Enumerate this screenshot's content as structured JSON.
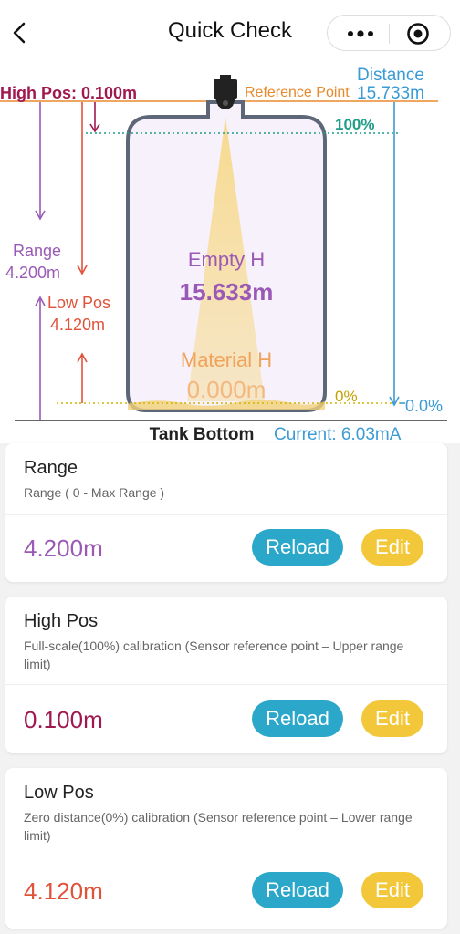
{
  "header": {
    "title": "Quick Check"
  },
  "diagram": {
    "high_pos_label": "High Pos: 0.100m",
    "reference_point": "Reference Point",
    "distance_label": "Distance",
    "distance_value": "15.733m",
    "percent_100": "100%",
    "percent_0": "0%",
    "zero_percent_right": "0.0%",
    "range_label": "Range",
    "range_value": "4.200m",
    "low_pos_label": "Low Pos",
    "low_pos_value": "4.120m",
    "empty_h_label": "Empty H",
    "empty_h_value": "15.633m",
    "material_h_label": "Material H",
    "material_h_value": "0.000m",
    "tank_bottom": "Tank Bottom",
    "current": "Current: 6.03mA"
  },
  "cards": {
    "range": {
      "title": "Range",
      "desc": "Range ( 0 - Max Range )",
      "value": "4.200m",
      "reload": "Reload",
      "edit": "Edit"
    },
    "high_pos": {
      "title": "High Pos",
      "desc": "Full-scale(100%) calibration (Sensor reference point – Upper range limit)",
      "value": "0.100m",
      "reload": "Reload",
      "edit": "Edit"
    },
    "low_pos": {
      "title": "Low Pos",
      "desc": "Zero distance(0%) calibration (Sensor reference point – Lower range limit)",
      "value": "4.120m",
      "reload": "Reload",
      "edit": "Edit"
    }
  },
  "colors": {
    "range_purple": "#9b59b6",
    "high_pos_maroon": "#a0184f",
    "low_pos_red": "#e0533a",
    "reload_blue": "#2ba8c9",
    "edit_yellow": "#f2c83a",
    "reference_orange": "#e8882c",
    "distance_blue": "#3a9bd5",
    "percent_teal": "#1f9e89"
  }
}
